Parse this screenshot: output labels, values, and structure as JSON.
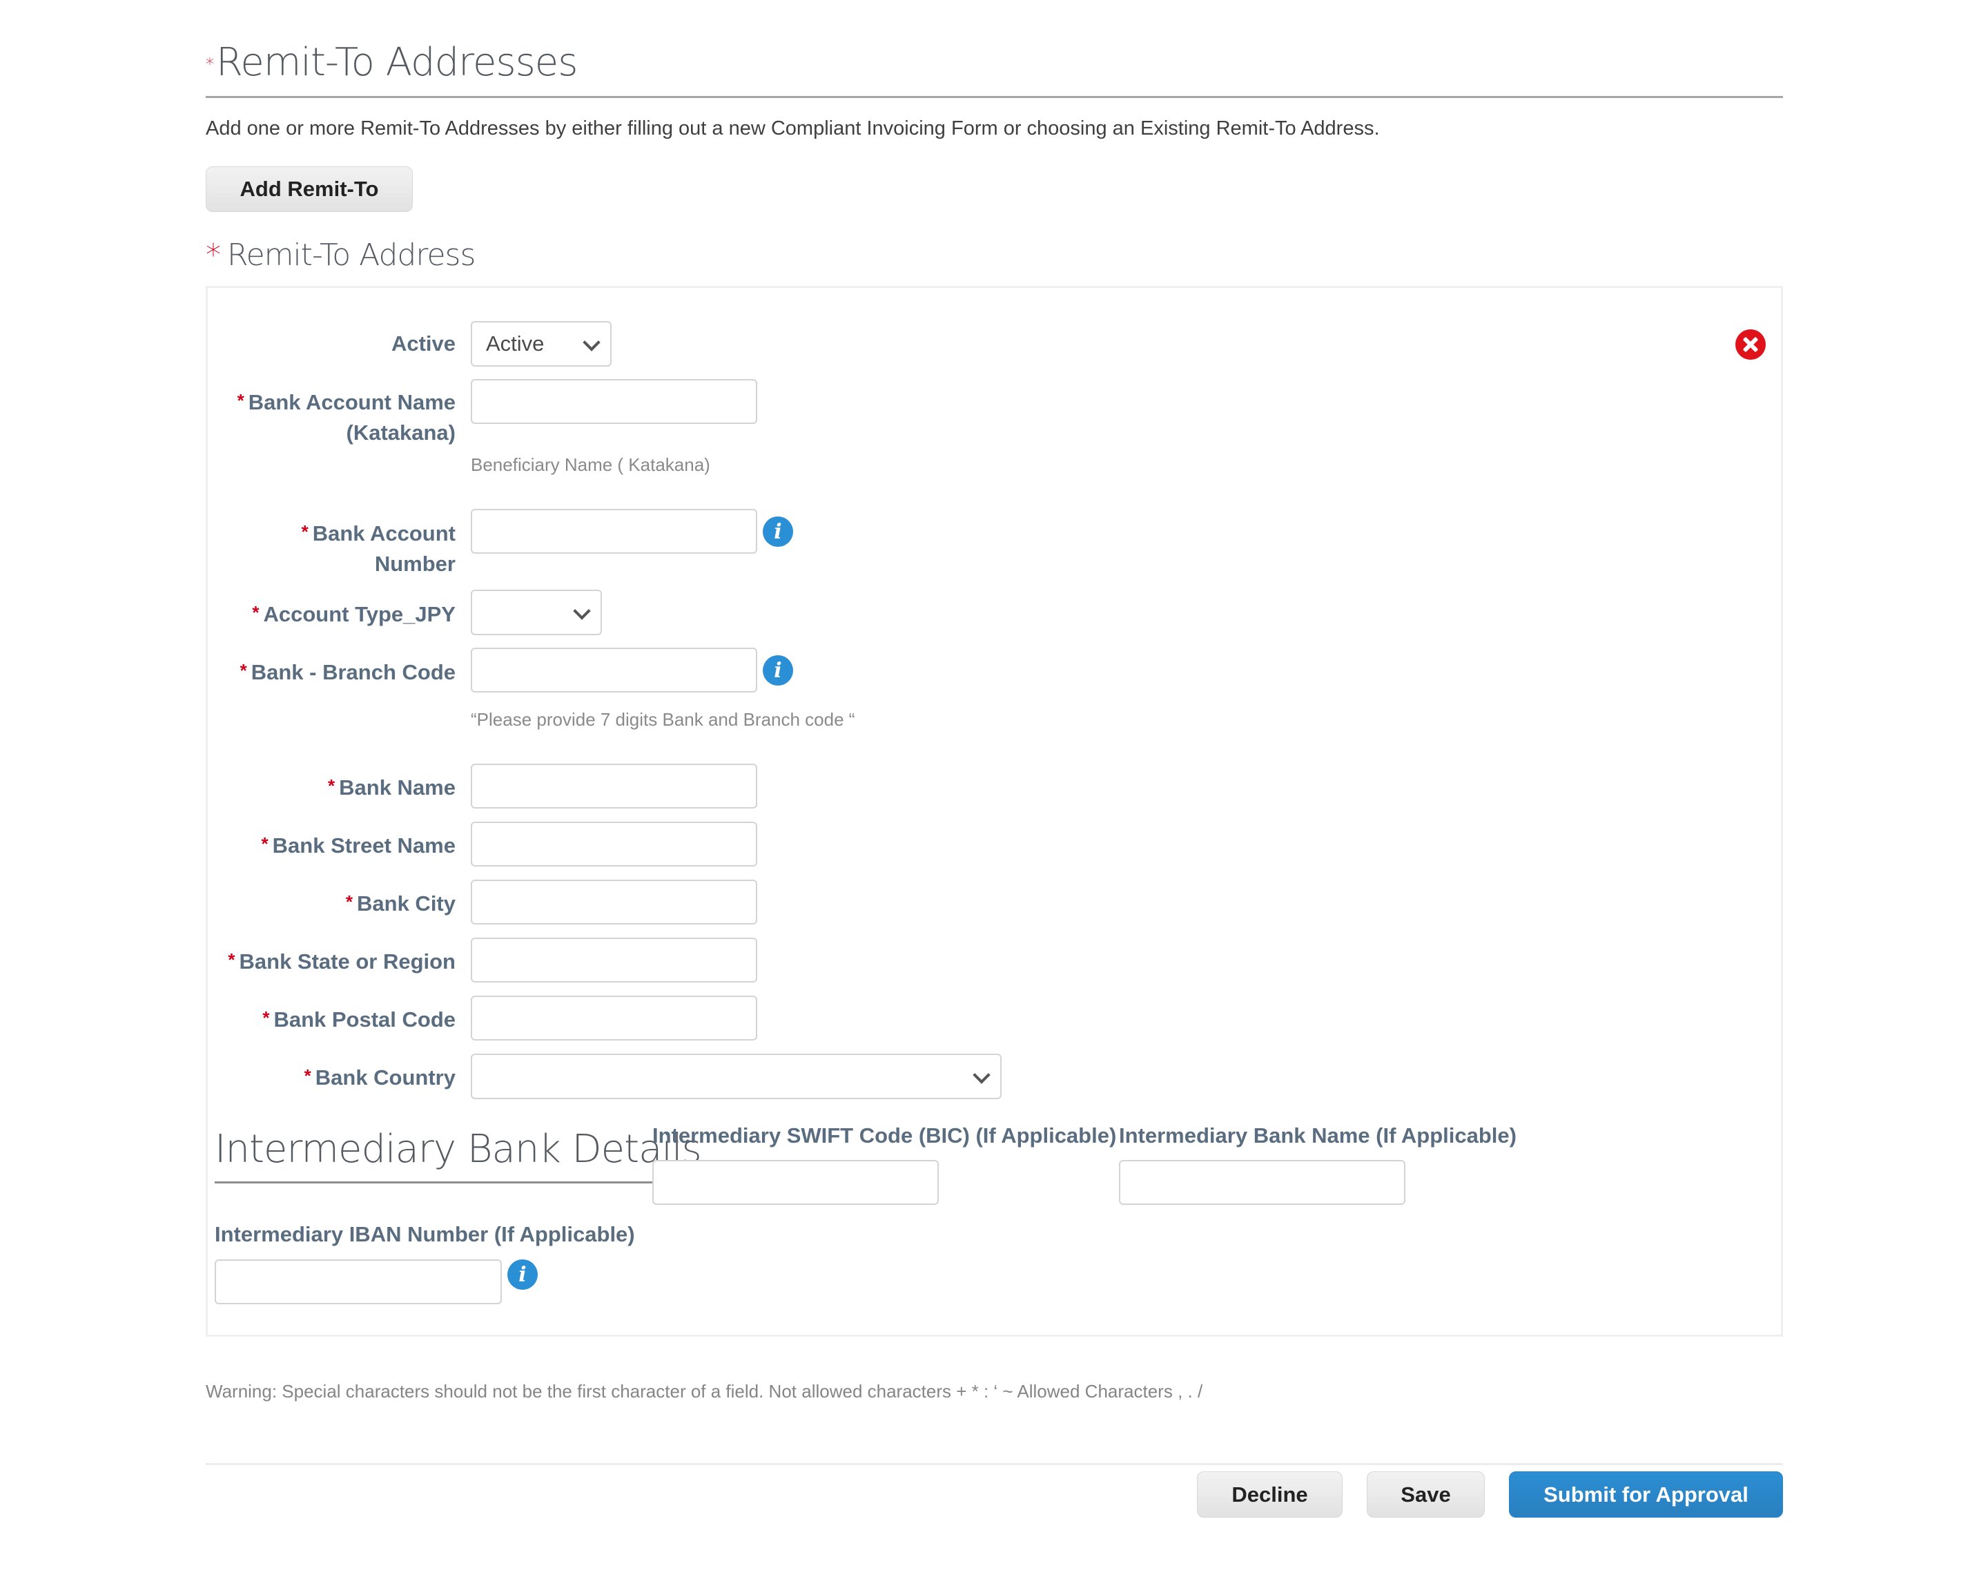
{
  "section": {
    "title": "Remit-To Addresses",
    "required_mark": "*",
    "description": "Add one or more Remit-To Addresses by either filling out a new Compliant Invoicing Form or choosing an Existing Remit-To Address.",
    "add_button": "Add Remit-To"
  },
  "address": {
    "title": "Remit-To Address",
    "required_mark": "*",
    "remove_icon": "close-circle-icon",
    "active": {
      "label": "Active",
      "value": "Active"
    },
    "fields": {
      "bank_account_name": {
        "label_line1": "Bank Account Name",
        "label_line2": "(Katakana)",
        "value": "",
        "hint": "Beneficiary Name ( Katakana)"
      },
      "bank_account_number": {
        "label_line1": "Bank Account",
        "label_line2": "Number",
        "value": "",
        "info_icon": "info-icon"
      },
      "account_type": {
        "label": "Account Type_JPY",
        "value": ""
      },
      "branch_code": {
        "label": "Bank - Branch Code",
        "value": "",
        "hint": "“Please provide 7 digits Bank and Branch code “",
        "info_icon": "info-icon"
      },
      "bank_name": {
        "label": "Bank Name",
        "value": ""
      },
      "bank_street": {
        "label": "Bank Street Name",
        "value": ""
      },
      "bank_city": {
        "label": "Bank City",
        "value": ""
      },
      "bank_state": {
        "label": "Bank State or Region",
        "value": ""
      },
      "bank_postal": {
        "label": "Bank Postal Code",
        "value": ""
      },
      "bank_country": {
        "label": "Bank Country",
        "value": ""
      }
    },
    "intermediary": {
      "title": "Intermediary Bank Details",
      "swift_label": "Intermediary SWIFT Code (BIC) (If Applicable)",
      "swift_value": "",
      "bank_name_label": "Intermediary Bank Name (If Applicable)",
      "bank_name_value": "",
      "iban_label": "Intermediary IBAN Number (If Applicable)",
      "iban_value": ""
    }
  },
  "warning": "Warning: Special characters should not be the first character of a field. Not allowed characters + * : ‘ ~ Allowed Characters , . /",
  "footer": {
    "decline": "Decline",
    "save": "Save",
    "submit": "Submit for Approval"
  },
  "colors": {
    "required": "#d0021b",
    "label": "#5a6d80",
    "primary": "#2b8ed3",
    "info": "#2b8fd6",
    "remove": "#e0121a"
  }
}
